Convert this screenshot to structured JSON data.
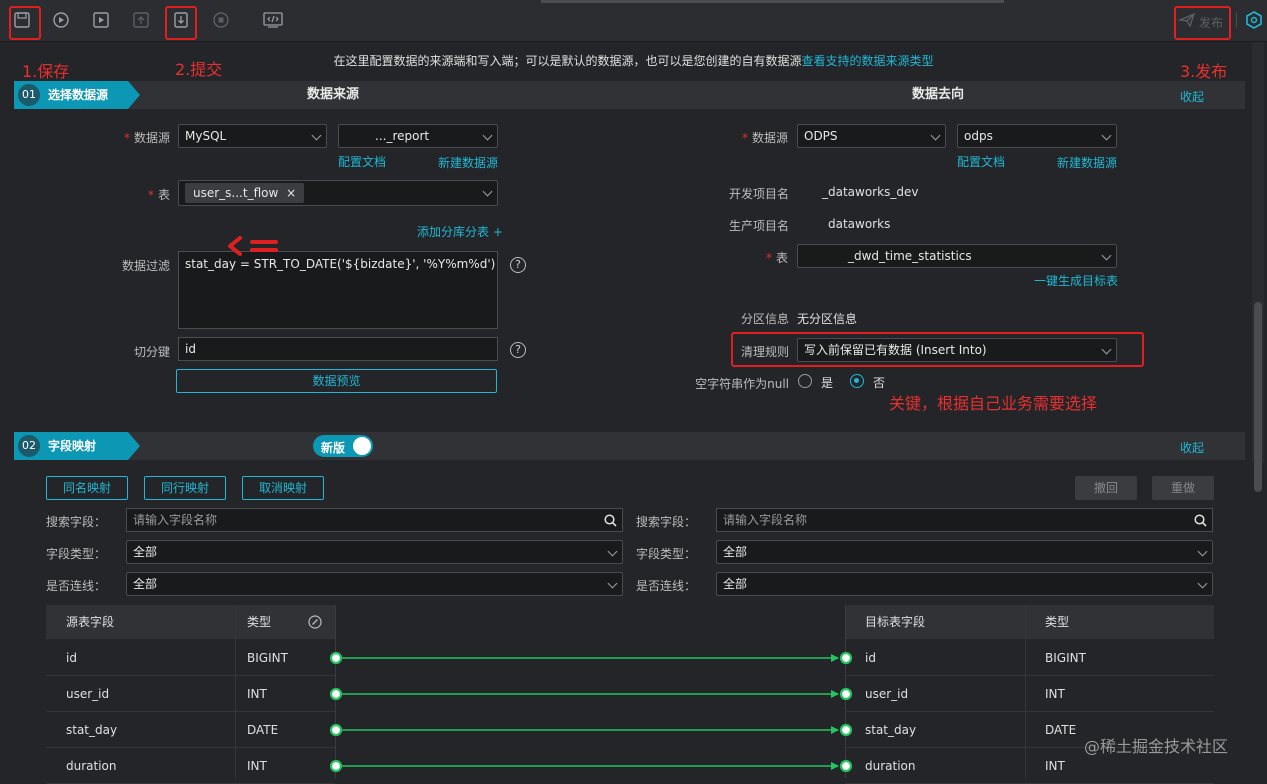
{
  "toolbar": {
    "publish_label": "发布"
  },
  "annotations": {
    "save_note": "1.保存",
    "submit_note": "2.提交",
    "publish_note": "3.发布",
    "key_note": "关键，根据自己业务需要选择"
  },
  "info": {
    "text": "在这里配置数据的来源端和写入端；可以是默认的数据源，也可以是您创建的自有数据源",
    "link": "查看支持的数据来源类型"
  },
  "section1": {
    "num": "01",
    "tag": "选择数据源",
    "source_title": "数据来源",
    "target_title": "数据去向",
    "collapse": "收起"
  },
  "source": {
    "ds_label": "数据源",
    "ds_type": "MySQL",
    "ds_name": "..._report",
    "config_doc": "配置文档",
    "new_ds": "新建数据源",
    "table_label": "表",
    "table_tag": "user_s...t_flow",
    "add_shard": "添加分库分表 +",
    "filter_label": "数据过滤",
    "filter_value": "stat_day = STR_TO_DATE('${bizdate}', '%Y%m%d')",
    "split_label": "切分键",
    "split_value": "id",
    "preview_button": "数据预览",
    "qmark": "?"
  },
  "target": {
    "ds_label": "数据源",
    "ds_type": "ODPS",
    "ds_name": "odps",
    "config_doc": "配置文档",
    "new_ds": "新建数据源",
    "dev_label": "开发项目名",
    "dev_value": "_dataworks_dev",
    "prod_label": "生产项目名",
    "prod_value": "dataworks",
    "table_label": "表",
    "table_value": "_dwd_time_statistics",
    "gen_table": "一键生成目标表",
    "partition_label": "分区信息",
    "partition_value": "无分区信息",
    "clean_label": "清理规则",
    "clean_value": "写入前保留已有数据 (Insert Into)",
    "null_label": "空字符串作为null",
    "yes": "是",
    "no": "否"
  },
  "section2": {
    "num": "02",
    "tag": "字段映射",
    "toggle_label": "新版",
    "collapse": "收起"
  },
  "mapping": {
    "same_name": "同名映射",
    "same_row": "同行映射",
    "cancel": "取消映射",
    "undo": "撤回",
    "redo": "重做",
    "search_label": "搜索字段：",
    "search_placeholder": "请输入字段名称",
    "type_label": "字段类型：",
    "type_value": "全部",
    "conn_label": "是否连线：",
    "conn_value": "全部",
    "src_col_field": "源表字段",
    "src_col_type": "类型",
    "dst_col_field": "目标表字段",
    "dst_col_type": "类型",
    "rows": [
      {
        "src": "id",
        "src_type": "BIGINT",
        "dst": "id",
        "dst_type": "BIGINT"
      },
      {
        "src": "user_id",
        "src_type": "INT",
        "dst": "user_id",
        "dst_type": "INT"
      },
      {
        "src": "stat_day",
        "src_type": "DATE",
        "dst": "stat_day",
        "dst_type": "DATE"
      },
      {
        "src": "duration",
        "src_type": "INT",
        "dst": "duration",
        "dst_type": "INT"
      }
    ]
  },
  "watermark": "@稀土掘金技术社区",
  "colors": {
    "accent": "#1fb8d6",
    "annotation": "#e02020",
    "link_line": "#22c55e"
  }
}
